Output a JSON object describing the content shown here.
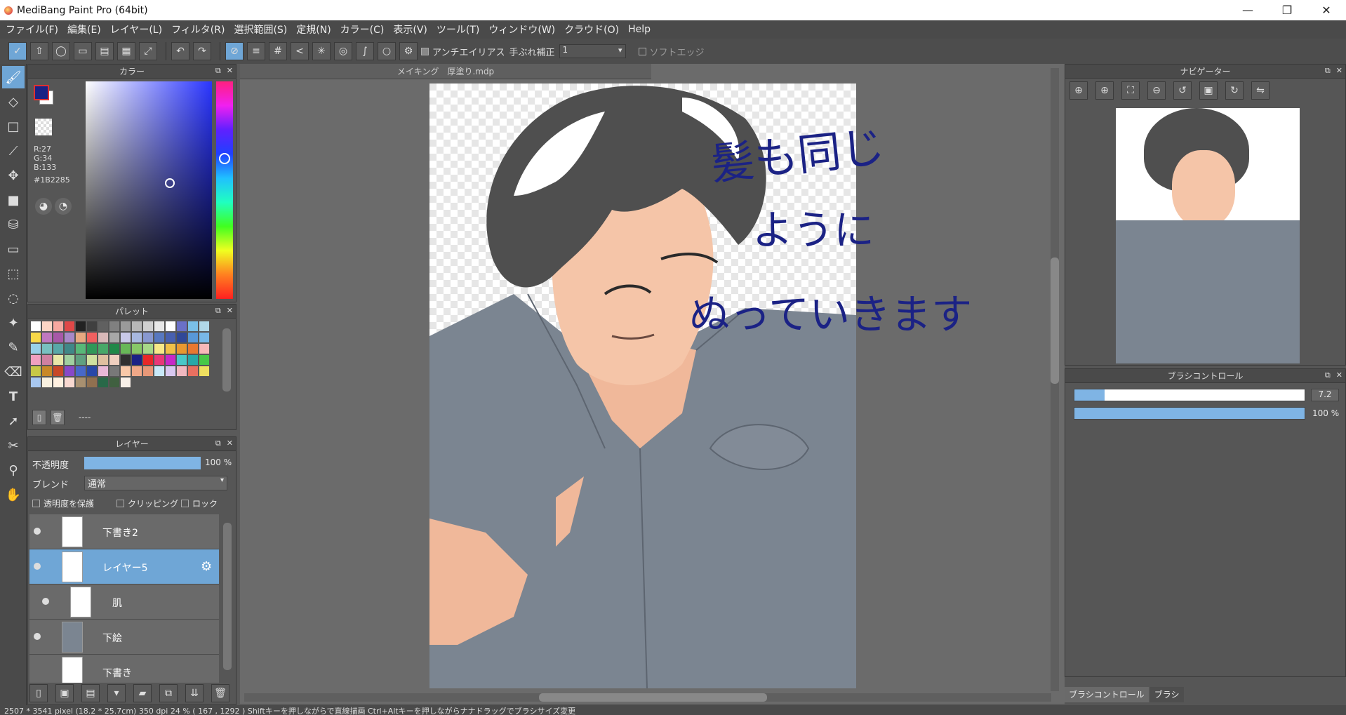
{
  "window": {
    "title": "MediBang Paint Pro (64bit)",
    "minimize": "—",
    "maximize": "❐",
    "close": "✕"
  },
  "menu": [
    "ファイル(F)",
    "編集(E)",
    "レイヤー(L)",
    "フィルタ(R)",
    "選択範囲(S)",
    "定規(N)",
    "カラー(C)",
    "表示(V)",
    "ツール(T)",
    "ウィンドウ(W)",
    "クラウド(O)",
    "Help"
  ],
  "toolbar": {
    "antialias_label": "アンチエイリアス",
    "stabilizer_label": "手ぶれ補正",
    "stabilizer_value": "1",
    "softedge_label": "ソフトエッジ"
  },
  "color_panel": {
    "title": "カラー",
    "r": "R:27",
    "g": "G:34",
    "b": "B:133",
    "hex": "#1B2285",
    "foreground": "#1b2285",
    "background": "#ffffff"
  },
  "palette_panel": {
    "title": "パレット",
    "name": "----",
    "colors": [
      "#ffffff",
      "#fcd5c5",
      "#f7a8a0",
      "#e04848",
      "#222222",
      "#404040",
      "#606060",
      "#808080",
      "#9a9a9a",
      "#b8b8b8",
      "#d0d0d0",
      "#e8e8e8",
      "#ffffff",
      "#6a70c8",
      "#7ac0e8",
      "#b0d8e8",
      "#f8d848",
      "#c078c0",
      "#a858a8",
      "#a888c8",
      "#e8a880",
      "#f06060",
      "#d8b8b8",
      "#a8a8a8",
      "#c8c8e8",
      "#a8b8e0",
      "#8898d0",
      "#5878c0",
      "#4860b0",
      "#304898",
      "#5898d8",
      "#78b8e8",
      "#98d0e8",
      "#78c0c0",
      "#58a8a8",
      "#408888",
      "#58b878",
      "#309858",
      "#48a868",
      "#208848",
      "#68b858",
      "#88c868",
      "#a8d888",
      "#f8e888",
      "#f0c048",
      "#e89830",
      "#e87830",
      "#f8b8b8",
      "#f0a0c0",
      "#d080a0",
      "#e8e8a8",
      "#a0d0a0",
      "#60a080",
      "#d0e0a0",
      "#e0c0a0",
      "#f0d0c0",
      "#303030",
      "#1b2285",
      "#e82828",
      "#e83878",
      "#c828c8",
      "#48c8c8",
      "#28a8a8",
      "#48c848",
      "#c8c848",
      "#c88828",
      "#c84828",
      "#8848c8",
      "#4868c8",
      "#2848a8",
      "#e8b8d8",
      "#787878",
      "#f8c8a8",
      "#f0a888",
      "#e89878",
      "#c8e8f8",
      "#d8c8f0",
      "#f0b8c0",
      "#e87060",
      "#f0e060",
      "#a8c8f0",
      "#f8f0e0",
      "#fff0e0",
      "#f8d8d0",
      "#a89070",
      "#907050",
      "#286848",
      "#406040",
      "#f8f0e8"
    ]
  },
  "layer_panel": {
    "title": "レイヤー",
    "opacity_label": "不透明度",
    "opacity_value": "100 %",
    "opacity_fraction": 1.0,
    "blend_label": "ブレンド",
    "blend_value": "通常",
    "protect_alpha_label": "透明度を保護",
    "clipping_label": "クリッピング",
    "lock_label": "ロック",
    "layers": [
      {
        "name": "下書き2",
        "selected": false,
        "visible": true
      },
      {
        "name": "レイヤー5",
        "selected": true,
        "visible": true
      },
      {
        "name": "肌",
        "selected": false,
        "visible": true
      },
      {
        "name": "下絵",
        "selected": false,
        "visible": true
      },
      {
        "name": "下書き",
        "selected": false,
        "visible": false
      }
    ]
  },
  "document": {
    "tab": "メイキング　厚塗り.mdp"
  },
  "annotation": {
    "line1": "髪も同じ",
    "line2": "ように",
    "line3": "ぬっていきます",
    "color": "#1b2285"
  },
  "navigator": {
    "title": "ナビゲーター"
  },
  "brush_control": {
    "title": "ブラシコントロール",
    "size_value": "7.2",
    "size_fraction": 0.13,
    "opacity_value": "100 %",
    "opacity_fraction": 1.0,
    "tab1": "ブラシコントロール",
    "tab2": "ブラシ"
  },
  "status": {
    "text": "2507 * 3541 pixel   (18.2 * 25.7cm)   350 dpi   24 %   (   167 , 1292 )   Shiftキーを押しながらで直線描画   Ctrl+Altキーを押しながらナナドラッグでブラシサイズ変更"
  }
}
